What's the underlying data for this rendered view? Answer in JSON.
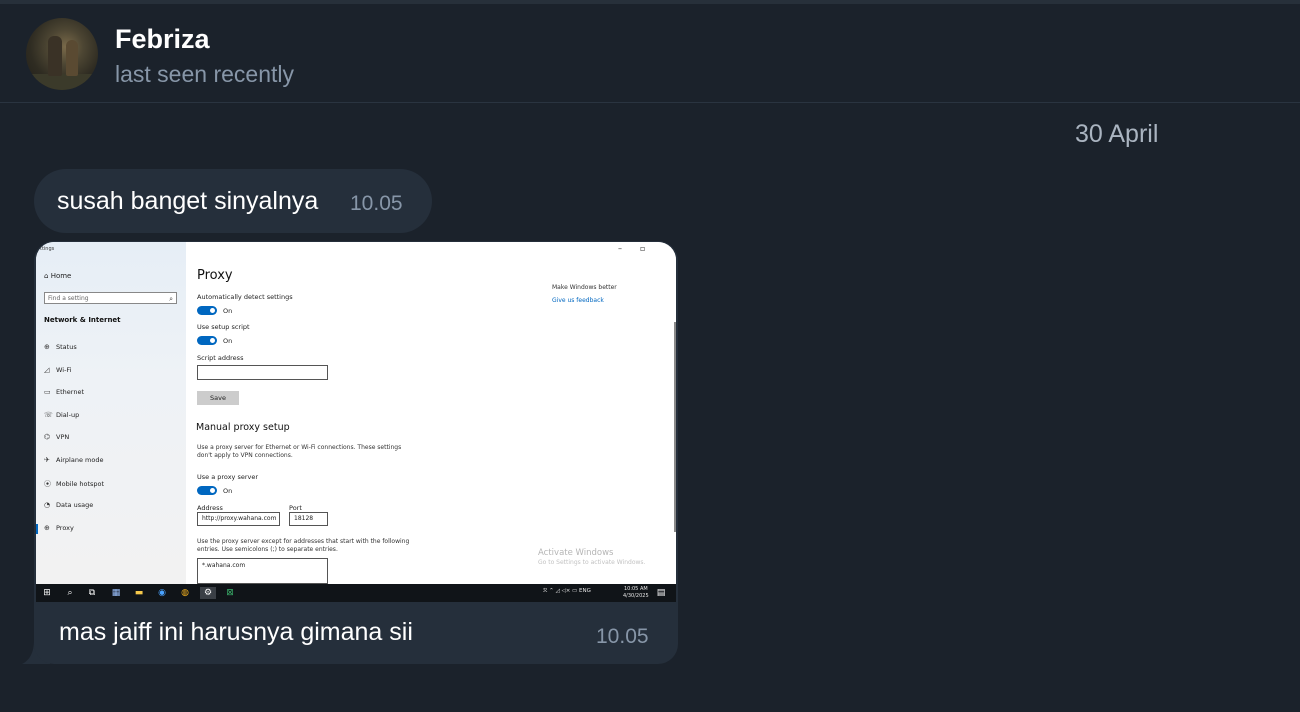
{
  "contact": {
    "name": "Febriza",
    "status": "last seen recently"
  },
  "date_separator": "30 April",
  "messages": [
    {
      "text": "susah banget sinyalnya",
      "time": "10.05"
    },
    {
      "caption": "mas jaiff ini harusnya gimana sii",
      "time": "10.05"
    }
  ],
  "screenshot": {
    "window_label": "ttings",
    "home": "Home",
    "find_placeholder": "Find a setting",
    "section": "Network & Internet",
    "nav": [
      "Status",
      "Wi-Fi",
      "Ethernet",
      "Dial-up",
      "VPN",
      "Airplane mode",
      "Mobile hotspot",
      "Data usage",
      "Proxy"
    ],
    "title": "Proxy",
    "auto_detect": "Automatically detect settings",
    "on": "On",
    "use_setup_script": "Use setup script",
    "script_address": "Script address",
    "save": "Save",
    "manual_title": "Manual proxy setup",
    "manual_desc": "Use a proxy server for Ethernet or Wi-Fi connections. These settings\ndon't apply to VPN connections.",
    "use_proxy": "Use a proxy server",
    "address_label": "Address",
    "address_value": "http://proxy.wahana.com",
    "port_label": "Port",
    "port_value": "18128",
    "except_desc": "Use the proxy server except for addresses that start with the following\nentries. Use semicolons (;) to separate entries.",
    "except_value": "*.wahana.com",
    "make_windows_better": "Make Windows better",
    "feedback": "Give us feedback",
    "activate": "Activate Windows",
    "activate_sub": "Go to Settings to activate Windows.",
    "tray": "ENG",
    "clock_time": "10:05 AM",
    "clock_date": "4/30/2025"
  },
  "colors": {
    "background": "#1b222b",
    "bubble": "#252f3b",
    "accent": "#0067c0",
    "meta": "#8796a8"
  }
}
